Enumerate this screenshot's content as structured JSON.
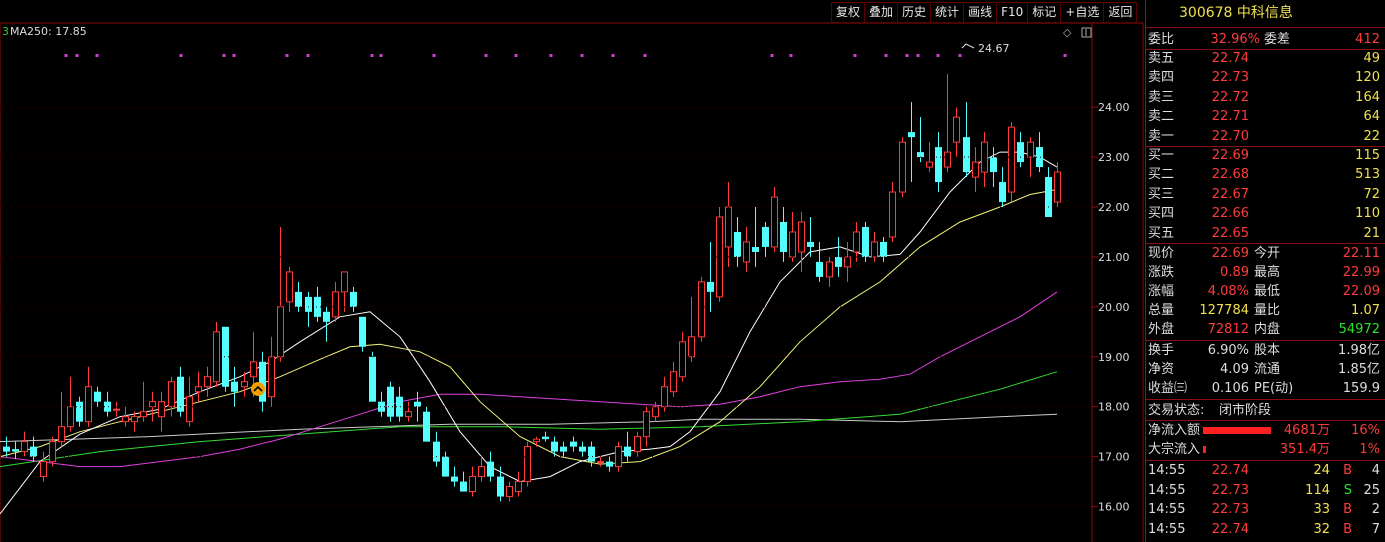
{
  "toolbar": [
    "复权",
    "叠加",
    "历史",
    "统计",
    "画线",
    "F10",
    "标记",
    "+自选",
    "返回"
  ],
  "ma_label": "MA250: 17.85",
  "price_axis": [
    "24.00",
    "23.00",
    "22.00",
    "21.00",
    "20.00",
    "19.00",
    "18.00",
    "17.00",
    "16.00"
  ],
  "peak_label": "24.67",
  "colors": {
    "up": "#ff3b3b",
    "down": "#54ffff",
    "ma5": "#ffffff",
    "ma10": "#f3f37a",
    "ma20": "#e040e0",
    "ma60": "#33dd33",
    "ma250": "#cccccc",
    "bg": "#000000"
  },
  "stock": {
    "code": "300678",
    "name": "中科信息"
  },
  "weibi": {
    "label": "委比",
    "value": "32.96%",
    "label2": "委差",
    "value2": "412"
  },
  "asks": [
    {
      "label": "卖五",
      "price": "22.74",
      "vol": "49"
    },
    {
      "label": "卖四",
      "price": "22.73",
      "vol": "120"
    },
    {
      "label": "卖三",
      "price": "22.72",
      "vol": "164"
    },
    {
      "label": "卖二",
      "price": "22.71",
      "vol": "64"
    },
    {
      "label": "卖一",
      "price": "22.70",
      "vol": "22"
    }
  ],
  "bids": [
    {
      "label": "买一",
      "price": "22.69",
      "vol": "115"
    },
    {
      "label": "买二",
      "price": "22.68",
      "vol": "513"
    },
    {
      "label": "买三",
      "price": "22.67",
      "vol": "72"
    },
    {
      "label": "买四",
      "price": "22.66",
      "vol": "110"
    },
    {
      "label": "买五",
      "price": "22.65",
      "vol": "21"
    }
  ],
  "quote": {
    "xj_l": "现价",
    "xj": "22.69",
    "jk_l": "今开",
    "jk": "22.11",
    "zd_l": "涨跌",
    "zd": "0.89",
    "zg_l": "最高",
    "zg": "22.99",
    "zf_l": "涨幅",
    "zf": "4.08%",
    "zdi_l": "最低",
    "zdi": "22.09",
    "zl_l": "总量",
    "zl": "127784",
    "lb_l": "量比",
    "lb": "1.07",
    "wp_l": "外盘",
    "wp": "72812",
    "np_l": "内盘",
    "np": "54972"
  },
  "fund": {
    "hs_l": "换手",
    "hs": "6.90%",
    "gb_l": "股本",
    "gb": "1.98亿",
    "jz_l": "净资",
    "jz": "4.09",
    "lt_l": "流通",
    "lt": "1.85亿",
    "sy_l": "收益㈢",
    "sy": "0.106",
    "pe_l": "PE(动)",
    "pe": "159.9"
  },
  "status": {
    "label": "交易状态:",
    "value": "闭市阶段"
  },
  "flow": {
    "net_l": "净流入额",
    "net": "4681万",
    "net_pct": "16%",
    "blk_l": "大宗流入",
    "blk": "351.4万",
    "blk_pct": "1%"
  },
  "ticks": [
    {
      "time": "14:55",
      "price": "22.74",
      "vol": "24",
      "side": "B",
      "n": "4"
    },
    {
      "time": "14:55",
      "price": "22.73",
      "vol": "114",
      "side": "S",
      "n": "25"
    },
    {
      "time": "14:55",
      "price": "22.73",
      "vol": "33",
      "side": "B",
      "n": "2"
    },
    {
      "time": "14:55",
      "price": "22.74",
      "vol": "32",
      "side": "B",
      "n": "7"
    }
  ],
  "chart_data": {
    "type": "candlestick",
    "ylim": [
      15.6,
      24.9
    ],
    "candles": [
      {
        "o": 17.2,
        "h": 17.4,
        "l": 17.0,
        "c": 17.1
      },
      {
        "o": 17.15,
        "h": 17.3,
        "l": 16.95,
        "c": 17.1
      },
      {
        "o": 17.1,
        "h": 17.5,
        "l": 17.0,
        "c": 17.3
      },
      {
        "o": 17.2,
        "h": 17.4,
        "l": 16.9,
        "c": 17.0
      },
      {
        "o": 16.6,
        "h": 17.1,
        "l": 16.5,
        "c": 16.9
      },
      {
        "o": 16.9,
        "h": 17.4,
        "l": 16.8,
        "c": 17.3
      },
      {
        "o": 17.3,
        "h": 18.3,
        "l": 17.2,
        "c": 17.6
      },
      {
        "o": 17.6,
        "h": 18.6,
        "l": 17.5,
        "c": 18.0
      },
      {
        "o": 18.1,
        "h": 18.2,
        "l": 17.6,
        "c": 17.7
      },
      {
        "o": 17.7,
        "h": 18.8,
        "l": 17.6,
        "c": 18.4
      },
      {
        "o": 18.3,
        "h": 18.4,
        "l": 18.0,
        "c": 18.1
      },
      {
        "o": 18.1,
        "h": 18.3,
        "l": 17.8,
        "c": 17.9
      },
      {
        "o": 17.95,
        "h": 18.1,
        "l": 17.8,
        "c": 17.95
      },
      {
        "o": 17.7,
        "h": 18.0,
        "l": 17.6,
        "c": 17.8
      },
      {
        "o": 17.7,
        "h": 17.9,
        "l": 17.5,
        "c": 17.8
      },
      {
        "o": 17.8,
        "h": 18.5,
        "l": 17.7,
        "c": 17.9
      },
      {
        "o": 18.0,
        "h": 18.3,
        "l": 17.7,
        "c": 18.1
      },
      {
        "o": 17.8,
        "h": 18.3,
        "l": 17.5,
        "c": 18.1
      },
      {
        "o": 18.0,
        "h": 18.6,
        "l": 17.8,
        "c": 18.5
      },
      {
        "o": 18.6,
        "h": 18.8,
        "l": 17.8,
        "c": 17.9
      },
      {
        "o": 17.7,
        "h": 18.6,
        "l": 17.6,
        "c": 18.2
      },
      {
        "o": 18.3,
        "h": 18.7,
        "l": 18.1,
        "c": 18.4
      },
      {
        "o": 18.4,
        "h": 18.8,
        "l": 18.2,
        "c": 18.6
      },
      {
        "o": 18.5,
        "h": 19.7,
        "l": 18.4,
        "c": 19.5
      },
      {
        "o": 19.6,
        "h": 19.6,
        "l": 18.3,
        "c": 18.4
      },
      {
        "o": 18.5,
        "h": 18.8,
        "l": 18.0,
        "c": 18.3
      },
      {
        "o": 18.4,
        "h": 18.7,
        "l": 18.2,
        "c": 18.5
      },
      {
        "o": 18.6,
        "h": 19.5,
        "l": 18.2,
        "c": 18.9
      },
      {
        "o": 18.9,
        "h": 19.1,
        "l": 17.9,
        "c": 18.1
      },
      {
        "o": 18.2,
        "h": 19.4,
        "l": 18.0,
        "c": 19.0
      },
      {
        "o": 19.0,
        "h": 21.6,
        "l": 18.9,
        "c": 20.0
      },
      {
        "o": 20.1,
        "h": 20.8,
        "l": 19.9,
        "c": 20.7
      },
      {
        "o": 20.3,
        "h": 20.5,
        "l": 19.9,
        "c": 20.0
      },
      {
        "o": 20.2,
        "h": 20.3,
        "l": 19.6,
        "c": 19.9
      },
      {
        "o": 20.2,
        "h": 20.4,
        "l": 19.7,
        "c": 19.8
      },
      {
        "o": 19.9,
        "h": 20.0,
        "l": 19.3,
        "c": 19.7
      },
      {
        "o": 19.8,
        "h": 20.5,
        "l": 19.7,
        "c": 20.3
      },
      {
        "o": 20.3,
        "h": 20.7,
        "l": 19.9,
        "c": 20.7
      },
      {
        "o": 20.3,
        "h": 20.4,
        "l": 19.9,
        "c": 20.0
      },
      {
        "o": 19.8,
        "h": 19.8,
        "l": 19.1,
        "c": 19.2
      },
      {
        "o": 19.0,
        "h": 19.1,
        "l": 18.2,
        "c": 18.1
      },
      {
        "o": 18.1,
        "h": 18.3,
        "l": 17.8,
        "c": 17.9
      },
      {
        "o": 18.4,
        "h": 18.5,
        "l": 17.7,
        "c": 17.8
      },
      {
        "o": 18.2,
        "h": 18.4,
        "l": 17.7,
        "c": 17.8
      },
      {
        "o": 17.8,
        "h": 18.1,
        "l": 17.7,
        "c": 17.9
      },
      {
        "o": 18.1,
        "h": 18.3,
        "l": 17.7,
        "c": 18.0
      },
      {
        "o": 17.9,
        "h": 18.0,
        "l": 17.3,
        "c": 17.3
      },
      {
        "o": 17.3,
        "h": 17.5,
        "l": 16.8,
        "c": 16.9
      },
      {
        "o": 17.0,
        "h": 17.1,
        "l": 16.6,
        "c": 16.6
      },
      {
        "o": 16.6,
        "h": 16.8,
        "l": 16.4,
        "c": 16.5
      },
      {
        "o": 16.5,
        "h": 16.7,
        "l": 16.3,
        "c": 16.3
      },
      {
        "o": 16.3,
        "h": 16.8,
        "l": 16.2,
        "c": 16.6
      },
      {
        "o": 16.6,
        "h": 17.0,
        "l": 16.5,
        "c": 16.8
      },
      {
        "o": 16.9,
        "h": 17.1,
        "l": 16.5,
        "c": 16.6
      },
      {
        "o": 16.6,
        "h": 16.8,
        "l": 16.1,
        "c": 16.2
      },
      {
        "o": 16.2,
        "h": 16.5,
        "l": 16.1,
        "c": 16.4
      },
      {
        "o": 16.3,
        "h": 16.7,
        "l": 16.2,
        "c": 16.5
      },
      {
        "o": 16.5,
        "h": 17.3,
        "l": 16.4,
        "c": 17.2
      },
      {
        "o": 17.3,
        "h": 17.4,
        "l": 17.2,
        "c": 17.35
      },
      {
        "o": 17.4,
        "h": 17.5,
        "l": 17.3,
        "c": 17.35
      },
      {
        "o": 17.3,
        "h": 17.4,
        "l": 17.0,
        "c": 17.1
      },
      {
        "o": 17.2,
        "h": 17.3,
        "l": 17.0,
        "c": 17.1
      },
      {
        "o": 17.3,
        "h": 17.4,
        "l": 17.1,
        "c": 17.2
      },
      {
        "o": 17.2,
        "h": 17.3,
        "l": 17.0,
        "c": 17.1
      },
      {
        "o": 17.2,
        "h": 17.3,
        "l": 16.8,
        "c": 16.9
      },
      {
        "o": 16.9,
        "h": 17.0,
        "l": 16.8,
        "c": 16.9
      },
      {
        "o": 16.9,
        "h": 17.0,
        "l": 16.7,
        "c": 16.8
      },
      {
        "o": 16.8,
        "h": 17.3,
        "l": 16.7,
        "c": 17.2
      },
      {
        "o": 17.2,
        "h": 17.5,
        "l": 16.9,
        "c": 17.0
      },
      {
        "o": 17.1,
        "h": 17.5,
        "l": 17.0,
        "c": 17.4
      },
      {
        "o": 17.4,
        "h": 18.0,
        "l": 17.2,
        "c": 17.9
      },
      {
        "o": 17.8,
        "h": 18.1,
        "l": 17.7,
        "c": 18.0
      },
      {
        "o": 18.0,
        "h": 18.6,
        "l": 17.9,
        "c": 18.4
      },
      {
        "o": 18.3,
        "h": 18.9,
        "l": 18.2,
        "c": 18.7
      },
      {
        "o": 18.6,
        "h": 19.5,
        "l": 18.5,
        "c": 19.3
      },
      {
        "o": 19.0,
        "h": 20.2,
        "l": 18.9,
        "c": 19.4
      },
      {
        "o": 19.4,
        "h": 20.6,
        "l": 19.3,
        "c": 20.5
      },
      {
        "o": 20.5,
        "h": 21.3,
        "l": 19.9,
        "c": 20.3
      },
      {
        "o": 20.2,
        "h": 22.0,
        "l": 20.1,
        "c": 21.8
      },
      {
        "o": 21.2,
        "h": 22.5,
        "l": 20.8,
        "c": 22.0
      },
      {
        "o": 21.5,
        "h": 21.8,
        "l": 20.8,
        "c": 21.0
      },
      {
        "o": 20.9,
        "h": 21.6,
        "l": 20.7,
        "c": 21.3
      },
      {
        "o": 21.2,
        "h": 22.0,
        "l": 20.8,
        "c": 21.1
      },
      {
        "o": 21.6,
        "h": 21.7,
        "l": 21.0,
        "c": 21.2
      },
      {
        "o": 21.2,
        "h": 22.4,
        "l": 21.1,
        "c": 22.2
      },
      {
        "o": 21.7,
        "h": 22.0,
        "l": 20.9,
        "c": 21.1
      },
      {
        "o": 21.0,
        "h": 21.9,
        "l": 20.9,
        "c": 21.5
      },
      {
        "o": 21.1,
        "h": 21.9,
        "l": 20.7,
        "c": 21.7
      },
      {
        "o": 21.3,
        "h": 21.8,
        "l": 21.0,
        "c": 21.2
      },
      {
        "o": 20.9,
        "h": 21.3,
        "l": 20.5,
        "c": 20.6
      },
      {
        "o": 20.6,
        "h": 21.0,
        "l": 20.4,
        "c": 20.9
      },
      {
        "o": 21.0,
        "h": 21.4,
        "l": 20.6,
        "c": 20.8
      },
      {
        "o": 20.8,
        "h": 21.3,
        "l": 20.5,
        "c": 21.0
      },
      {
        "o": 21.1,
        "h": 21.7,
        "l": 20.9,
        "c": 21.5
      },
      {
        "o": 21.6,
        "h": 21.7,
        "l": 20.9,
        "c": 21.0
      },
      {
        "o": 21.0,
        "h": 21.5,
        "l": 20.9,
        "c": 21.3
      },
      {
        "o": 21.3,
        "h": 21.4,
        "l": 20.9,
        "c": 21.0
      },
      {
        "o": 21.4,
        "h": 22.5,
        "l": 21.3,
        "c": 22.3
      },
      {
        "o": 22.3,
        "h": 23.4,
        "l": 22.2,
        "c": 23.3
      },
      {
        "o": 23.5,
        "h": 24.1,
        "l": 22.5,
        "c": 23.4
      },
      {
        "o": 23.1,
        "h": 23.8,
        "l": 22.9,
        "c": 23.0
      },
      {
        "o": 22.8,
        "h": 23.3,
        "l": 22.7,
        "c": 22.9
      },
      {
        "o": 23.2,
        "h": 23.5,
        "l": 22.3,
        "c": 22.5
      },
      {
        "o": 22.8,
        "h": 24.67,
        "l": 22.7,
        "c": 23.1
      },
      {
        "o": 23.3,
        "h": 24.0,
        "l": 23.0,
        "c": 23.8
      },
      {
        "o": 23.4,
        "h": 24.1,
        "l": 22.6,
        "c": 22.7
      },
      {
        "o": 22.6,
        "h": 23.2,
        "l": 22.3,
        "c": 22.9
      },
      {
        "o": 22.7,
        "h": 23.5,
        "l": 22.4,
        "c": 23.3
      },
      {
        "o": 23.0,
        "h": 23.2,
        "l": 22.4,
        "c": 22.7
      },
      {
        "o": 22.5,
        "h": 22.8,
        "l": 22.0,
        "c": 22.1
      },
      {
        "o": 22.3,
        "h": 23.7,
        "l": 22.1,
        "c": 23.6
      },
      {
        "o": 23.3,
        "h": 23.5,
        "l": 22.8,
        "c": 22.9
      },
      {
        "o": 23.0,
        "h": 23.4,
        "l": 22.6,
        "c": 23.3
      },
      {
        "o": 23.2,
        "h": 23.5,
        "l": 22.7,
        "c": 22.8
      },
      {
        "o": 22.6,
        "h": 22.8,
        "l": 21.8,
        "c": 21.8
      },
      {
        "o": 22.1,
        "h": 22.9,
        "l": 22.0,
        "c": 22.7
      }
    ],
    "ma5": [
      [
        0,
        15.85
      ],
      [
        40,
        16.9
      ],
      [
        80,
        17.45
      ],
      [
        120,
        17.8
      ],
      [
        160,
        17.95
      ],
      [
        200,
        18.3
      ],
      [
        240,
        18.6
      ],
      [
        270,
        18.9
      ],
      [
        300,
        19.3
      ],
      [
        340,
        19.8
      ],
      [
        370,
        19.9
      ],
      [
        400,
        19.4
      ],
      [
        430,
        18.5
      ],
      [
        460,
        17.5
      ],
      [
        490,
        16.8
      ],
      [
        520,
        16.5
      ],
      [
        550,
        16.6
      ],
      [
        580,
        16.9
      ],
      [
        620,
        17.1
      ],
      [
        650,
        17.15
      ],
      [
        670,
        17.2
      ],
      [
        690,
        17.5
      ],
      [
        720,
        18.3
      ],
      [
        750,
        19.5
      ],
      [
        780,
        20.5
      ],
      [
        810,
        21.1
      ],
      [
        840,
        21.2
      ],
      [
        870,
        21.0
      ],
      [
        900,
        21.05
      ],
      [
        920,
        21.5
      ],
      [
        950,
        22.3
      ],
      [
        980,
        22.9
      ],
      [
        1000,
        23.1
      ],
      [
        1020,
        23.1
      ],
      [
        1040,
        23.0
      ],
      [
        1057,
        22.8
      ]
    ],
    "ma10": [
      [
        0,
        17.0
      ],
      [
        40,
        17.2
      ],
      [
        80,
        17.5
      ],
      [
        120,
        17.7
      ],
      [
        160,
        17.9
      ],
      [
        200,
        18.1
      ],
      [
        240,
        18.3
      ],
      [
        280,
        18.6
      ],
      [
        320,
        18.95
      ],
      [
        350,
        19.2
      ],
      [
        380,
        19.25
      ],
      [
        420,
        19.1
      ],
      [
        450,
        18.8
      ],
      [
        480,
        18.1
      ],
      [
        520,
        17.4
      ],
      [
        560,
        17.0
      ],
      [
        600,
        16.85
      ],
      [
        640,
        16.9
      ],
      [
        680,
        17.2
      ],
      [
        720,
        17.7
      ],
      [
        760,
        18.4
      ],
      [
        800,
        19.3
      ],
      [
        840,
        20.0
      ],
      [
        880,
        20.5
      ],
      [
        920,
        21.2
      ],
      [
        960,
        21.7
      ],
      [
        1000,
        22.0
      ],
      [
        1030,
        22.25
      ],
      [
        1057,
        22.35
      ]
    ],
    "ma20": [
      [
        0,
        17.0
      ],
      [
        40,
        16.9
      ],
      [
        80,
        16.8
      ],
      [
        120,
        16.8
      ],
      [
        160,
        16.9
      ],
      [
        200,
        17.0
      ],
      [
        240,
        17.15
      ],
      [
        280,
        17.35
      ],
      [
        320,
        17.6
      ],
      [
        360,
        17.85
      ],
      [
        400,
        18.1
      ],
      [
        440,
        18.25
      ],
      [
        480,
        18.25
      ],
      [
        520,
        18.2
      ],
      [
        560,
        18.15
      ],
      [
        600,
        18.1
      ],
      [
        640,
        18.05
      ],
      [
        680,
        18.0
      ],
      [
        720,
        18.05
      ],
      [
        760,
        18.2
      ],
      [
        800,
        18.4
      ],
      [
        840,
        18.5
      ],
      [
        880,
        18.55
      ],
      [
        910,
        18.65
      ],
      [
        940,
        19.0
      ],
      [
        980,
        19.4
      ],
      [
        1020,
        19.8
      ],
      [
        1057,
        20.3
      ]
    ],
    "ma60": [
      [
        0,
        16.8
      ],
      [
        100,
        17.1
      ],
      [
        200,
        17.3
      ],
      [
        300,
        17.45
      ],
      [
        400,
        17.6
      ],
      [
        500,
        17.6
      ],
      [
        600,
        17.55
      ],
      [
        700,
        17.6
      ],
      [
        800,
        17.7
      ],
      [
        900,
        17.85
      ],
      [
        950,
        18.1
      ],
      [
        1000,
        18.35
      ],
      [
        1057,
        18.7
      ]
    ],
    "ma250": [
      [
        0,
        17.3
      ],
      [
        150,
        17.4
      ],
      [
        300,
        17.55
      ],
      [
        450,
        17.65
      ],
      [
        550,
        17.65
      ],
      [
        650,
        17.7
      ],
      [
        700,
        17.75
      ],
      [
        800,
        17.75
      ],
      [
        900,
        17.7
      ],
      [
        1000,
        17.8
      ],
      [
        1057,
        17.85
      ]
    ],
    "markers": [
      66,
      77,
      97,
      181,
      224,
      234,
      287,
      308,
      372,
      381,
      434,
      486,
      516,
      551,
      582,
      613,
      645,
      772,
      791,
      855,
      886,
      907,
      918,
      938,
      960,
      1065
    ]
  }
}
